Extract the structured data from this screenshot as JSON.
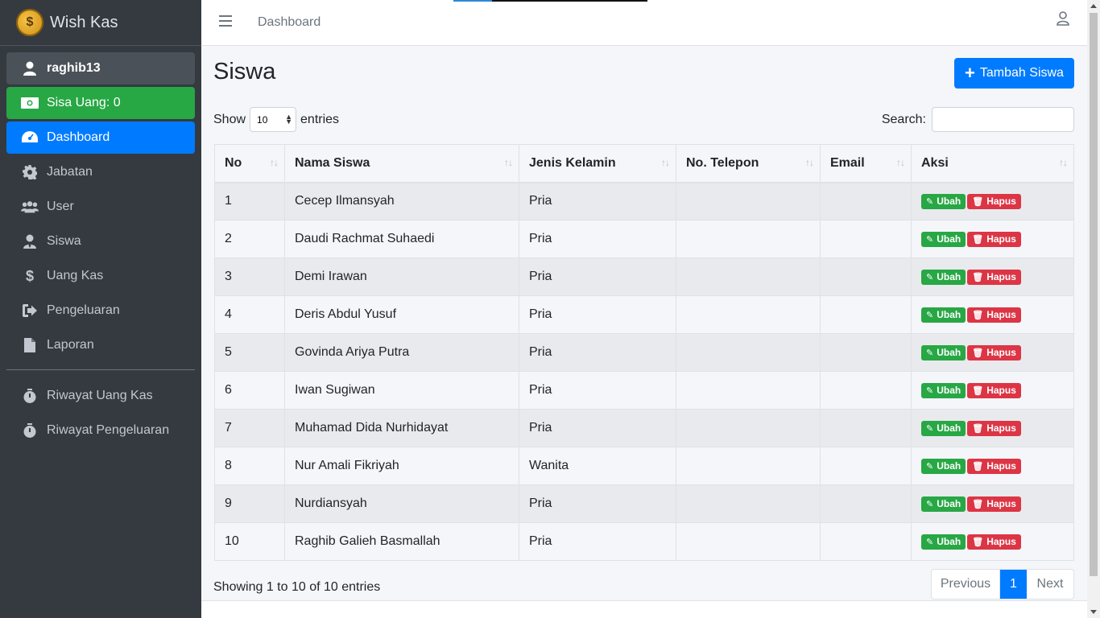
{
  "brand": {
    "name": "Wish Kas",
    "logo_symbol": "$"
  },
  "sidebar": {
    "user": "raghib13",
    "balance": "Sisa Uang: 0",
    "items": [
      {
        "label": "Dashboard",
        "icon": "tachometer-icon",
        "active": true
      },
      {
        "label": "Jabatan",
        "icon": "gear-icon"
      },
      {
        "label": "User",
        "icon": "users-icon"
      },
      {
        "label": "Siswa",
        "icon": "student-icon"
      },
      {
        "label": "Uang Kas",
        "icon": "dollar-icon"
      },
      {
        "label": "Pengeluaran",
        "icon": "sign-out-icon"
      },
      {
        "label": "Laporan",
        "icon": "file-icon"
      }
    ],
    "history": [
      {
        "label": "Riwayat Uang Kas",
        "icon": "stopwatch-icon"
      },
      {
        "label": "Riwayat Pengeluaran",
        "icon": "stopwatch-icon"
      }
    ]
  },
  "topbar": {
    "breadcrumb": "Dashboard"
  },
  "page": {
    "title": "Siswa",
    "add_button": "Tambah Siswa",
    "show_label": "Show",
    "entries_label": "entries",
    "page_size": "10",
    "search_label": "Search:",
    "search_value": ""
  },
  "table": {
    "columns": [
      "No",
      "Nama Siswa",
      "Jenis Kelamin",
      "No. Telepon",
      "Email",
      "Aksi"
    ],
    "rows": [
      {
        "no": "1",
        "nama": "Cecep Ilmansyah",
        "jk": "Pria",
        "telp": "",
        "email": ""
      },
      {
        "no": "2",
        "nama": "Daudi Rachmat Suhaedi",
        "jk": "Pria",
        "telp": "",
        "email": ""
      },
      {
        "no": "3",
        "nama": "Demi Irawan",
        "jk": "Pria",
        "telp": "",
        "email": ""
      },
      {
        "no": "4",
        "nama": "Deris Abdul Yusuf",
        "jk": "Pria",
        "telp": "",
        "email": ""
      },
      {
        "no": "5",
        "nama": "Govinda Ariya Putra",
        "jk": "Pria",
        "telp": "",
        "email": ""
      },
      {
        "no": "6",
        "nama": "Iwan Sugiwan",
        "jk": "Pria",
        "telp": "",
        "email": ""
      },
      {
        "no": "7",
        "nama": "Muhamad Dida Nurhidayat",
        "jk": "Pria",
        "telp": "",
        "email": ""
      },
      {
        "no": "8",
        "nama": "Nur Amali Fikriyah",
        "jk": "Wanita",
        "telp": "",
        "email": ""
      },
      {
        "no": "9",
        "nama": "Nurdiansyah",
        "jk": "Pria",
        "telp": "",
        "email": ""
      },
      {
        "no": "10",
        "nama": "Raghib Galieh Basmallah",
        "jk": "Pria",
        "telp": "",
        "email": ""
      }
    ],
    "edit_label": "Ubah",
    "delete_label": "Hapus"
  },
  "footer": {
    "info": "Showing 1 to 10 of 10 entries",
    "prev": "Previous",
    "current_page": "1",
    "next": "Next"
  },
  "colors": {
    "sidebar": "#343a40",
    "primary": "#007bff",
    "success": "#28a745",
    "danger": "#dc3545"
  }
}
